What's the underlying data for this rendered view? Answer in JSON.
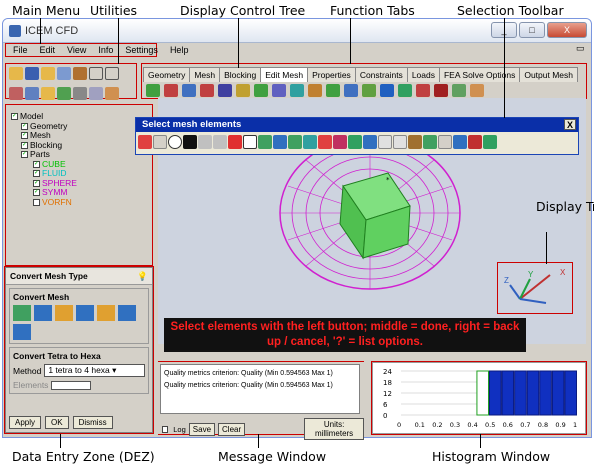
{
  "callouts": {
    "main_menu": "Main Menu",
    "utilities": "Utilities",
    "display_control_tree": "Display Control Tree",
    "function_tabs": "Function Tabs",
    "selection_toolbar": "Selection Toolbar",
    "display_triad": "Display Triad",
    "dez": "Data Entry Zone (DEZ)",
    "message_window": "Message Window",
    "histogram_window": "Histogram Window"
  },
  "window": {
    "title": "ICEM CFD",
    "minimize": "_",
    "maximize": "□",
    "close": "X"
  },
  "menu": [
    "File",
    "Edit",
    "View",
    "Info",
    "Settings",
    "Help"
  ],
  "tabs": [
    "Geometry",
    "Mesh",
    "Blocking",
    "Edit Mesh",
    "Properties",
    "Constraints",
    "Loads",
    "FEA Solve Options",
    "Output Mesh"
  ],
  "active_tab": "Edit Mesh",
  "tree": {
    "root": "Model",
    "items": [
      "Geometry",
      "Mesh",
      "Blocking",
      "Parts"
    ],
    "parts": [
      {
        "name": "CUBE",
        "color": "#00c000"
      },
      {
        "name": "FLUID",
        "color": "#00c0c0"
      },
      {
        "name": "SPHERE",
        "color": "#c000c0"
      },
      {
        "name": "SYMM",
        "color": "#c000c0"
      },
      {
        "name": "VORFN",
        "color": "#e07000"
      }
    ]
  },
  "selection_toolbar": {
    "title": "Select mesh elements",
    "close": "X"
  },
  "viewport_message": "Select elements with the left button; middle = done, right = back up / cancel, '?' = list options.",
  "dez": {
    "title": "Convert Mesh Type",
    "section1": "Convert Mesh",
    "section2": "Convert Tetra to Hexa",
    "method_label": "Method",
    "method_value": "1 tetra to 4 hexa",
    "elements_label": "Elements",
    "apply": "Apply",
    "ok": "OK",
    "dismiss": "Dismiss"
  },
  "message": {
    "lines": [
      "Quality metrics criterion: Quality (Min 0.594563 Max 1)",
      "Quality metrics criterion: Quality (Min 0.594563 Max 1)"
    ],
    "log": "Log",
    "save": "Save",
    "clear": "Clear",
    "units": "Units: millimeters"
  },
  "histogram": {
    "y_ticks": [
      "24",
      "18",
      "12",
      "6",
      "0"
    ],
    "x_ticks": [
      "0",
      "0.1",
      "0.2",
      "0.3",
      "0.4",
      "0.5",
      "0.6",
      "0.7",
      "0.8",
      "0.9",
      "1"
    ],
    "bars": [
      0,
      0,
      0,
      0,
      0,
      0,
      24,
      24,
      24,
      24,
      24,
      24,
      24,
      24
    ]
  },
  "triad": {
    "x": "X",
    "y": "Y",
    "z": "Z"
  },
  "colors": {
    "accent": "#cc0000",
    "mesh": "#d020d0",
    "cube": "#40c040"
  }
}
